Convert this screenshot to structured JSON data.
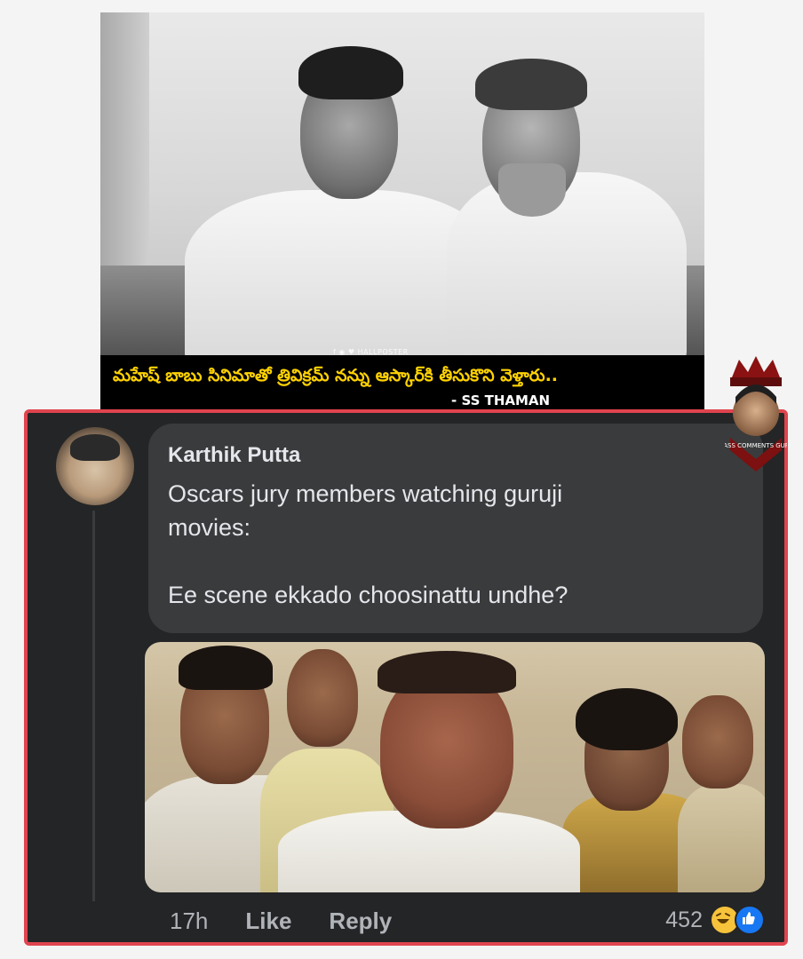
{
  "meme": {
    "watermark": "f ◉ ♥ HALLPOSTER",
    "caption": "మహేష్ బాబు సినిమాతో త్రివిక్రమ్ నన్ను ఆస్కార్‌కి తీసుకొని వెళ్తారు..",
    "attribution": "- SS THAMAN",
    "badge_text": "MASS COMMENTS GURU"
  },
  "comment": {
    "author": "Karthik Putta",
    "body": "Oscars jury members watching guruji\nmovies:\n\nEe scene ekkado choosinattu undhe?",
    "time": "17h",
    "like_label": "Like",
    "reply_label": "Reply",
    "reaction_count": "452",
    "reaction_icons": [
      "haha-icon",
      "like-icon"
    ]
  },
  "colors": {
    "panel_bg": "#242526",
    "bubble_bg": "#3a3b3c",
    "highlight_border": "#e0444f",
    "caption_text": "#ffd200",
    "text_primary": "#e4e6eb",
    "text_secondary": "#b0b3b8",
    "like_blue": "#1877f2"
  }
}
